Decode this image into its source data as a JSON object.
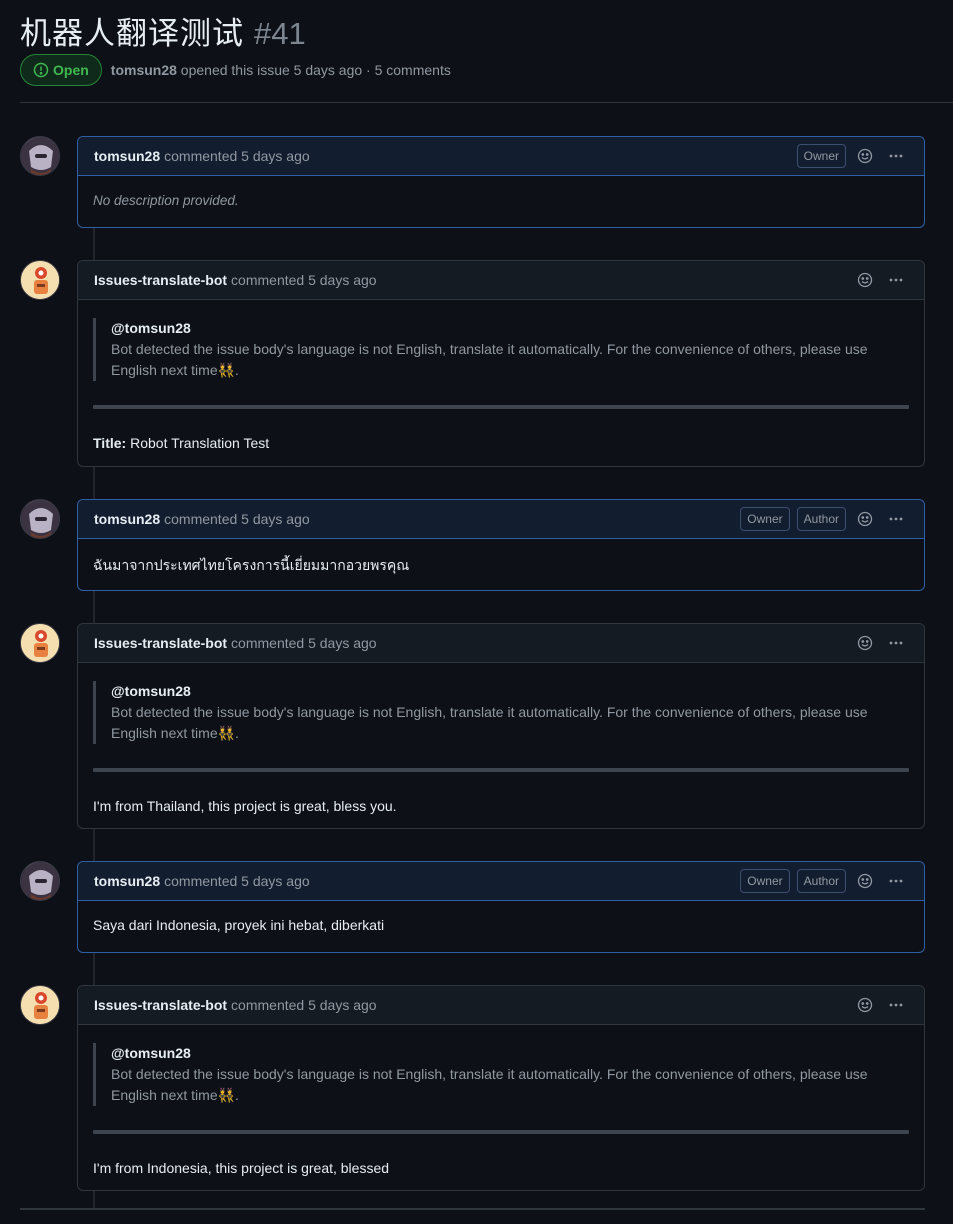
{
  "issue": {
    "title": "机器人翻译测试",
    "number": "#41",
    "state": "Open",
    "opened_by": "tomsun28",
    "meta_suffix": "opened this issue 5 days ago · 5 comments"
  },
  "comments": [
    {
      "author": "tomsun28",
      "action": "commented 5 days ago",
      "badges": [
        "Owner"
      ],
      "body": "No description provided."
    },
    {
      "author": "Issues-translate-bot",
      "action": "commented 5 days ago",
      "mention": "@tomsun28",
      "quote": "Bot detected the issue body's language is not English, translate it automatically. For the convenience of others, please use English next time",
      "quote_emoji": "👯",
      "body_label": "Title:",
      "body": "Robot Translation Test"
    },
    {
      "author": "tomsun28",
      "action": "commented 5 days ago",
      "badges": [
        "Owner",
        "Author"
      ],
      "body": "ฉันมาจากประเทศไทยโครงการนี้เยี่ยมมากอวยพรคุณ"
    },
    {
      "author": "Issues-translate-bot",
      "action": "commented 5 days ago",
      "mention": "@tomsun28",
      "quote": "Bot detected the issue body's language is not English, translate it automatically. For the convenience of others, please use English next time",
      "quote_emoji": "👯",
      "body": "I'm from Thailand, this project is great, bless you."
    },
    {
      "author": "tomsun28",
      "action": "commented 5 days ago",
      "badges": [
        "Owner",
        "Author"
      ],
      "body": "Saya dari Indonesia, proyek ini hebat, diberkati"
    },
    {
      "author": "Issues-translate-bot",
      "action": "commented 5 days ago",
      "mention": "@tomsun28",
      "quote": "Bot detected the issue body's language is not English, translate it automatically. For the convenience of others, please use English next time",
      "quote_emoji": "👯",
      "body": "I'm from Indonesia, this project is great, blessed"
    }
  ],
  "icons": {
    "state": "issue-opened-icon",
    "reaction": "smiley-icon",
    "menu": "kebab-horizontal-icon"
  },
  "colors": {
    "background": "#0d1117",
    "open_green": "#3fb950",
    "owner_border": "#2f5fa6",
    "muted_text": "#9198a1"
  }
}
